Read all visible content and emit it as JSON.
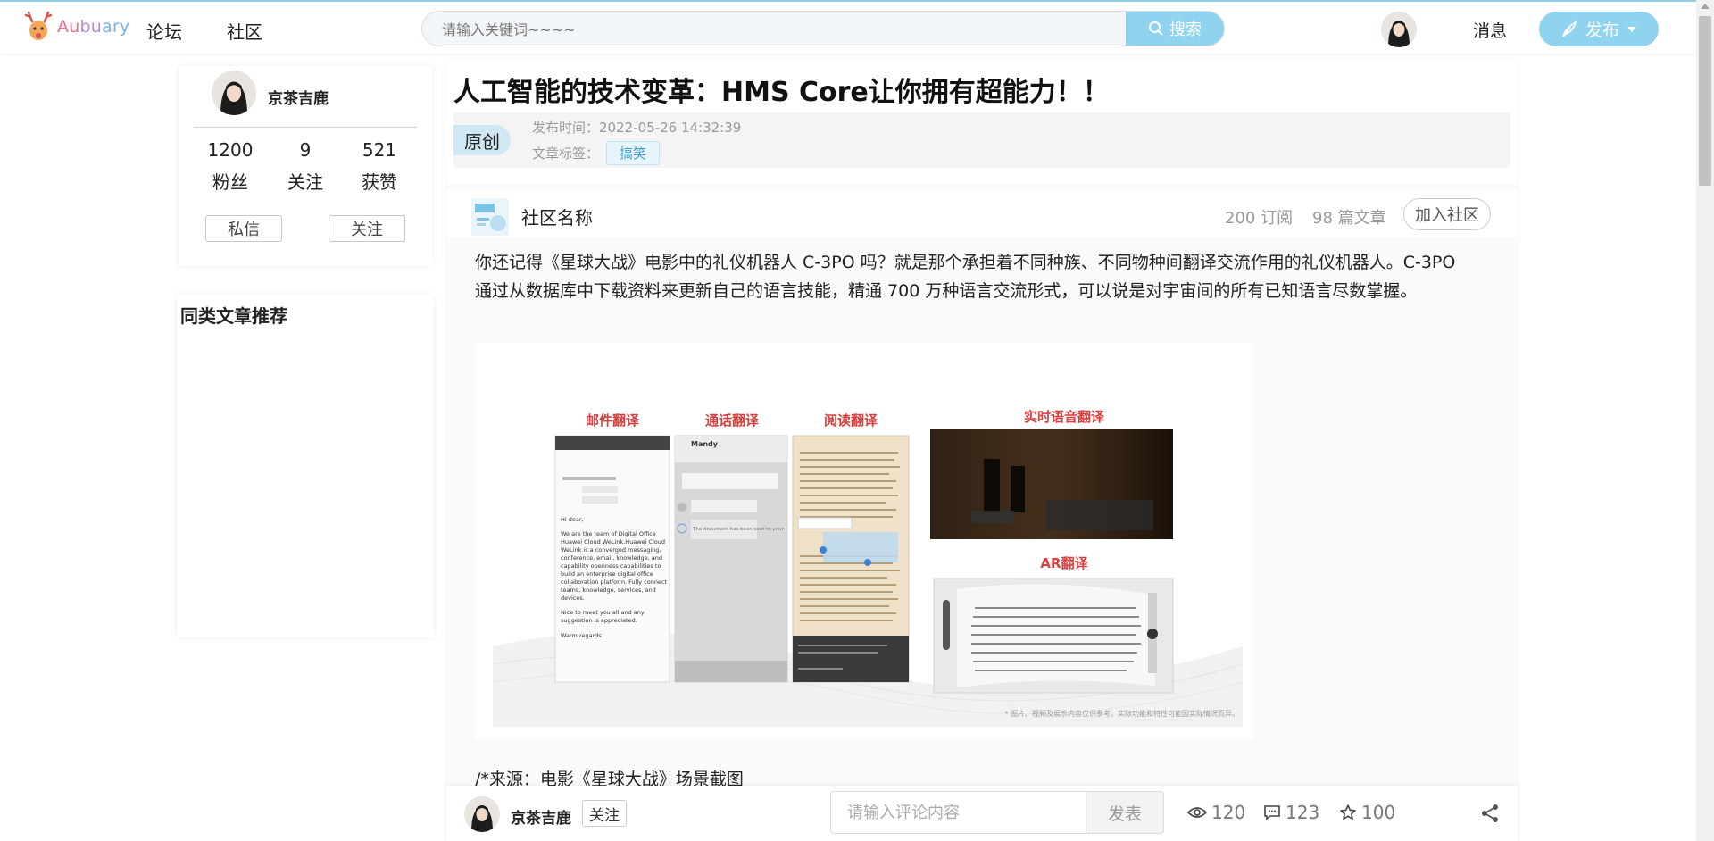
{
  "header": {
    "logo_text": "Aubuary",
    "nav": [
      "论坛",
      "社区"
    ],
    "search_placeholder": "请输入关键词~~~~",
    "search_button": "搜索",
    "messages_label": "消息",
    "publish_label": "发布"
  },
  "author": {
    "name": "京茶吉鹿",
    "stats": [
      {
        "value": "1200",
        "label": "粉丝"
      },
      {
        "value": "9",
        "label": "关注"
      },
      {
        "value": "521",
        "label": "获赞"
      }
    ],
    "message_button": "私信",
    "follow_button": "关注"
  },
  "recommend": {
    "title": "同类文章推荐"
  },
  "article": {
    "title": "人工智能的技术变革：HMS Core让你拥有超能力！！",
    "badge": "原创",
    "publish_time_label": "发布时间：",
    "publish_time": "2022-05-26 14:32:39",
    "tags_label": "文章标签：",
    "tag": "搞笑",
    "paragraph": "你还记得《星球大战》电影中的礼仪机器人 C-3PO 吗？就是那个承担着不同种族、不同物种间翻译交流作用的礼仪机器人。C-3PO 通过从数据库中下载资料来更新自己的语言技能，精通 700 万种语言交流形式，可以说是对宇宙间的所有已知语言尽数掌握。",
    "caption": "/*来源：电影《星球大战》场景截图"
  },
  "community": {
    "name": "社区名称",
    "subscriptions": "200 订阅",
    "articles": "98 篇文章",
    "join_button": "加入社区"
  },
  "figure": {
    "labels": [
      "邮件翻译",
      "通话翻译",
      "阅读翻译",
      "实时语音翻译",
      "AR翻译"
    ],
    "footnote": "* 图片、视频及展示内容仅供参考，实际功能和特性可能因实际情况而异。",
    "email_lines": [
      "Hi dear,",
      "We are the team of Digital Office",
      "Huawei Cloud WeLink.Huawei Cloud",
      "WeLink is a converged messaging,",
      "conference, email, knowledge, and",
      "capability openness capabilities to",
      "build an enterprise digital office",
      "collaboration platform. Fully connect",
      "teams, knowledge, services, and",
      "devices.",
      "Nice to meet you all and any",
      "suggestion is appreciated.",
      "Warm regards."
    ],
    "call_name": "Mandy",
    "call_bubble": "The document has been sent to your"
  },
  "bottom": {
    "author_name": "京茶吉鹿",
    "follow_button": "关注",
    "comment_placeholder": "请输入评论内容",
    "send_button": "发表",
    "views": "120",
    "comments": "123",
    "stars": "100"
  },
  "colors": {
    "accent": "#8fd3ee",
    "tag_text": "#3a9dd0",
    "figure_label": "#d64040"
  }
}
